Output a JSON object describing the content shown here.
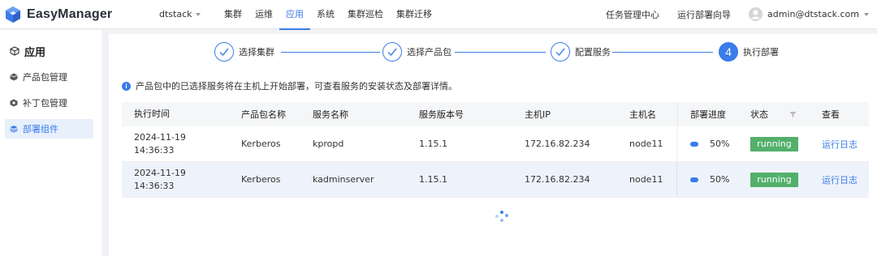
{
  "header": {
    "app_name": "EasyManager",
    "cluster": "dtstack",
    "nav": [
      "集群",
      "运维",
      "应用",
      "系统",
      "集群巡检",
      "集群迁移"
    ],
    "active_nav": 2,
    "links": [
      "任务管理中心",
      "运行部署向导"
    ],
    "user": "admin@dtstack.com"
  },
  "sidebar": {
    "title": "应用",
    "items": [
      {
        "label": "产品包管理",
        "icon": "package-icon"
      },
      {
        "label": "补丁包管理",
        "icon": "patch-icon"
      },
      {
        "label": "部署组件",
        "icon": "layers-icon"
      }
    ],
    "active_index": 2
  },
  "steps": [
    {
      "label": "选择集群",
      "state": "done"
    },
    {
      "label": "选择产品包",
      "state": "done"
    },
    {
      "label": "配置服务",
      "state": "done"
    },
    {
      "label": "执行部署",
      "state": "current",
      "number": "4"
    }
  ],
  "info_text": "产品包中的已选择服务将在主机上开始部署，可查看服务的安装状态及部署详情。",
  "table": {
    "columns": [
      "执行时间",
      "产品包名称",
      "服务名称",
      "服务版本号",
      "主机IP",
      "主机名",
      "部署进度",
      "状态",
      "查看"
    ],
    "rows": [
      {
        "date": "2024-11-19",
        "time": "14:36:33",
        "package": "Kerberos",
        "service": "kpropd",
        "version": "1.15.1",
        "ip": "172.16.82.234",
        "host": "node11",
        "progress": "50%",
        "status": "running",
        "view": "运行日志"
      },
      {
        "date": "2024-11-19",
        "time": "14:36:33",
        "package": "Kerberos",
        "service": "kadminserver",
        "version": "1.15.1",
        "ip": "172.16.82.234",
        "host": "node11",
        "progress": "50%",
        "status": "running",
        "view": "运行日志"
      }
    ]
  },
  "colors": {
    "accent": "#3a7ce8",
    "success": "#52b06b"
  }
}
